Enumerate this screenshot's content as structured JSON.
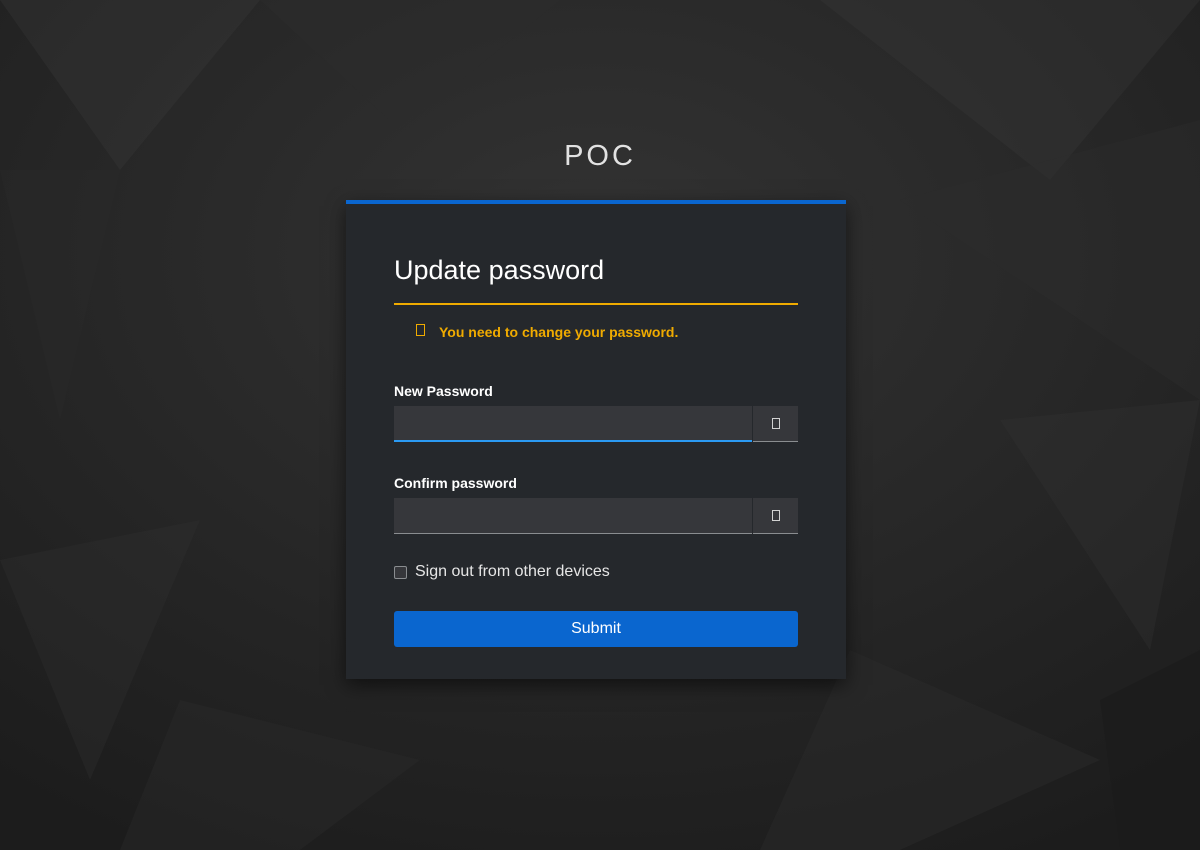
{
  "app": {
    "brand": "POC"
  },
  "form": {
    "title": "Update password",
    "alert": {
      "icon": "warning-icon",
      "message": "You need to change your password.",
      "color": "#f0ab00"
    },
    "new_password": {
      "label": "New Password",
      "value": "",
      "toggle_icon": "eye-icon"
    },
    "confirm_password": {
      "label": "Confirm password",
      "value": "",
      "toggle_icon": "eye-icon"
    },
    "logout_sessions": {
      "label": "Sign out from other devices",
      "checked": false
    },
    "submit_label": "Submit"
  },
  "colors": {
    "accent": "#0a66cf",
    "warning": "#f0ab00",
    "focus": "#2b9af3",
    "card_background": "#25282c"
  }
}
